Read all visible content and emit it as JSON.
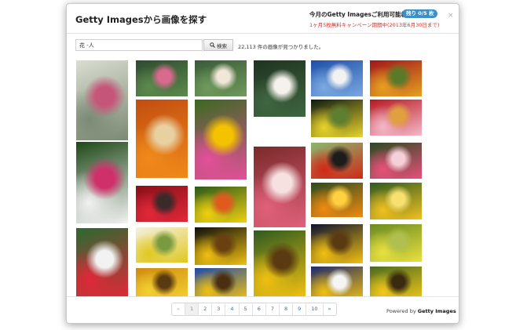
{
  "dialog": {
    "title": "Getty Imagesから画像を探す",
    "close_label": "×"
  },
  "quota": {
    "label": "今月のGetty Imagesご利用可能枚数",
    "badge": "残り 0/5 枚",
    "note": "1ヶ月5枚無料キャンペーン期間中(2013年6月30日まで)"
  },
  "search": {
    "query": "花 -人",
    "button_label": "検索",
    "result_text": "22,113 件の画像が見つかりました。"
  },
  "pagination": {
    "prev_label": "«",
    "pages": [
      "1",
      "2",
      "3",
      "4",
      "5",
      "6",
      "7",
      "8",
      "9",
      "10"
    ],
    "next_label": "»",
    "current": "1"
  },
  "footer": {
    "powered_prefix": "Powered by",
    "powered_brand": "Getty Images"
  },
  "colors": {
    "accent": "#3d8fc7",
    "warning": "#d9332e",
    "link": "#2f6fb3"
  },
  "thumbnails": [
    {
      "alt": "pink lotus buds on lily pads",
      "colors": [
        "#d9ddd0",
        "#7b8a74",
        "#c6557a"
      ]
    },
    {
      "alt": "pink lotus on dark green leaves",
      "colors": [
        "#2e4a30",
        "#5c8a4c",
        "#d9698f"
      ]
    },
    {
      "alt": "white lotus with lily pads",
      "colors": [
        "#3a5a38",
        "#6f9a5c",
        "#f2e6d8"
      ]
    },
    {
      "alt": "white water lilies on dark pond",
      "colors": [
        "#1f3320",
        "#3f6640",
        "#f5f1ec"
      ]
    },
    {
      "alt": "floating flowers in blue bowl",
      "colors": [
        "#1e4fa8",
        "#7aa8e0",
        "#f2f2f2"
      ]
    },
    {
      "alt": "red offering bowl with flowers",
      "colors": [
        "#a0161a",
        "#e5a020",
        "#5a7a2a"
      ]
    },
    {
      "alt": "orange marigold garland offering",
      "colors": [
        "#c24d10",
        "#f08a1a",
        "#e8d0a0"
      ]
    },
    {
      "alt": "pink gerbera daisy",
      "colors": [
        "#3a6a20",
        "#e44f9a",
        "#f5c200"
      ]
    },
    {
      "alt": "yellow water lily",
      "colors": [
        "#0d1a12",
        "#e8d42a",
        "#5f7f30"
      ]
    },
    {
      "alt": "red and pink flower offering",
      "colors": [
        "#b81822",
        "#f4b8c8",
        "#e0a040"
      ]
    },
    {
      "alt": "white and pink periwinkle flowers",
      "colors": [
        "#1e4818",
        "#f2f2f2",
        "#d0306a"
      ]
    },
    {
      "alt": "red celosia on black pot",
      "colors": [
        "#8ab870",
        "#d22818",
        "#1c1c1c"
      ]
    },
    {
      "alt": "pink lotus in garden",
      "colors": [
        "#2a4a20",
        "#e8507a",
        "#f5d0d8"
      ]
    },
    {
      "alt": "pink lotus flowers arrangement",
      "colors": [
        "#7a2a2a",
        "#e0607a",
        "#f6e0e0"
      ]
    },
    {
      "alt": "orange marigold close up",
      "colors": [
        "#2a4a20",
        "#f08a10",
        "#ffd040"
      ]
    },
    {
      "alt": "yellow gerbera daisy",
      "colors": [
        "#2e5a20",
        "#f0c020",
        "#f7e070"
      ]
    },
    {
      "alt": "red celosia field",
      "colors": [
        "#8a0f18",
        "#e02838",
        "#3a2a2a"
      ]
    },
    {
      "alt": "yellow hibiscus flower",
      "colors": [
        "#2a5a18",
        "#f0d010",
        "#e05a20"
      ]
    },
    {
      "alt": "sunflower on dark blue",
      "colors": [
        "#0e1230",
        "#f2c010",
        "#5a3a10"
      ]
    },
    {
      "alt": "yellow rapeseed field",
      "colors": [
        "#6a8a20",
        "#e8e040",
        "#b0c050"
      ]
    },
    {
      "alt": "yellow mustard flowers",
      "colors": [
        "#f5f0e0",
        "#e0c820",
        "#7a9a40"
      ]
    },
    {
      "alt": "sunflower on black",
      "colors": [
        "#0e0e0e",
        "#f0c010",
        "#6a4010"
      ]
    },
    {
      "alt": "red and white flower pattern",
      "colors": [
        "#2a6a30",
        "#e02838",
        "#f2f2f2"
      ]
    },
    {
      "alt": "sunflower with green leaves",
      "colors": [
        "#2e5a20",
        "#f0c010",
        "#5a3a10"
      ]
    },
    {
      "alt": "sunflower against blue sky",
      "colors": [
        "#1e2a6a",
        "#f0c010",
        "#f5f5f5"
      ]
    },
    {
      "alt": "sunflower close up",
      "colors": [
        "#4a6a20",
        "#f2c818",
        "#3a2a10"
      ]
    },
    {
      "alt": "sunflower field",
      "colors": [
        "#d08a10",
        "#f4d030",
        "#5a3a10"
      ]
    },
    {
      "alt": "sunflower on blue sky",
      "colors": [
        "#1e4aa8",
        "#f0c010",
        "#4a3010"
      ]
    }
  ]
}
